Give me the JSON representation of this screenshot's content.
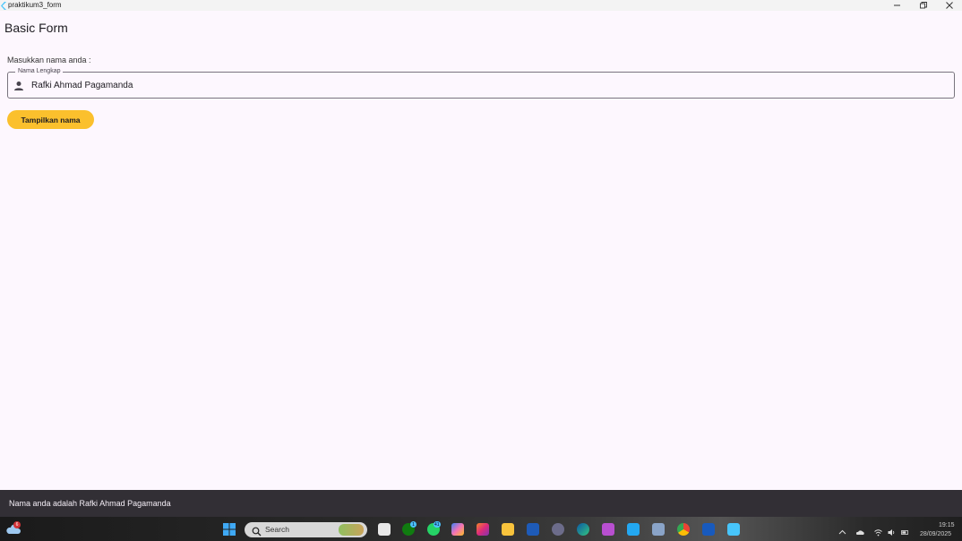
{
  "window": {
    "title": "praktikum3_form",
    "controls": [
      "minimize-icon",
      "restore-icon",
      "close-icon"
    ]
  },
  "app": {
    "page_title": "Basic Form",
    "field_caption": "Masukkan nama anda :",
    "field_label": "Nama Lengkap",
    "field_value": "Rafki Ahmad Pagamanda",
    "field_icon": "person-icon",
    "button_label": "Tampilkan nama",
    "accent_color": "#fbc02d"
  },
  "snackbar": {
    "message": "Nama anda adalah Rafki Ahmad Pagamanda"
  },
  "taskbar": {
    "weather_badge": "6",
    "search_placeholder": "Search",
    "xbox_badge": "1",
    "whatsapp_badge": "41",
    "time": "19:15",
    "date": "28/09/2025",
    "icons": [
      "weather-icon",
      "start-icon",
      "search-icon",
      "task-view-icon",
      "xbox-icon",
      "whatsapp-icon",
      "copilot-icon",
      "instagram-icon",
      "file-explorer-icon",
      "store-icon",
      "app-icon",
      "edge-icon",
      "outlook-icon",
      "vscode-icon",
      "photos-icon",
      "chrome-icon",
      "word-icon",
      "flutter-icon",
      "chevron-up-icon",
      "onedrive-icon",
      "wifi-icon",
      "volume-icon",
      "battery-icon"
    ]
  }
}
